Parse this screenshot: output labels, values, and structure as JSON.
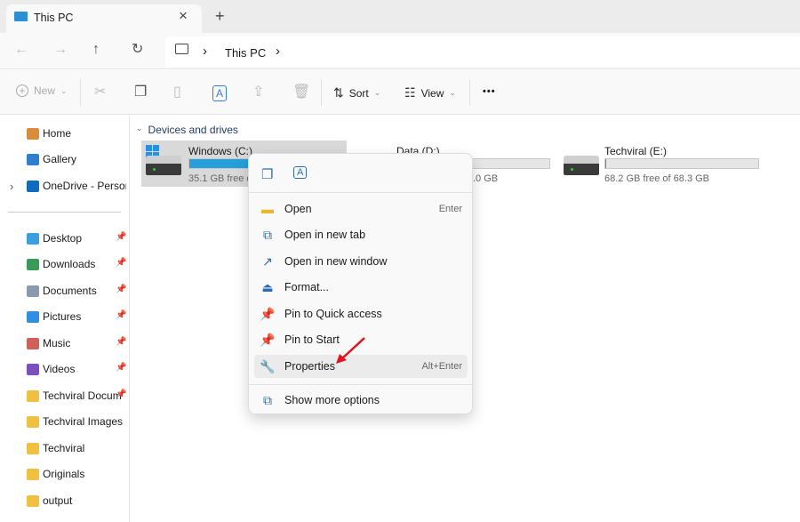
{
  "tab": {
    "title": "This PC",
    "close": "×",
    "new_tab": "+"
  },
  "nav": {
    "back": "←",
    "forward": "→",
    "up": "↑",
    "refresh": "↻",
    "crumb_sep": "›",
    "breadcrumb": "This PC"
  },
  "toolbar": {
    "new_label": "New",
    "sort_label": "Sort",
    "view_label": "View",
    "more": "•••",
    "chevron": "⌄"
  },
  "sidebar": {
    "items": [
      {
        "label": "Home",
        "icon": "home-icon",
        "color": "#d98c3a"
      },
      {
        "label": "Gallery",
        "icon": "gallery-icon",
        "color": "#2f7fd0"
      },
      {
        "label": "OneDrive - Persona",
        "icon": "cloud-icon",
        "color": "#0f6cbd"
      },
      {
        "label": "Desktop",
        "icon": "desktop-icon",
        "color": "#3aa0e0",
        "pinned": true
      },
      {
        "label": "Downloads",
        "icon": "download-icon",
        "color": "#3a9a5a",
        "pinned": true
      },
      {
        "label": "Documents",
        "icon": "document-icon",
        "color": "#8a9bb0",
        "pinned": true
      },
      {
        "label": "Pictures",
        "icon": "pictures-icon",
        "color": "#2f8fe0",
        "pinned": true
      },
      {
        "label": "Music",
        "icon": "music-icon",
        "color": "#d0605a",
        "pinned": true
      },
      {
        "label": "Videos",
        "icon": "videos-icon",
        "color": "#7a4fc0",
        "pinned": true
      },
      {
        "label": "Techviral Docum",
        "icon": "folder-icon",
        "color": "#f0c040",
        "pinned": true
      },
      {
        "label": "Techviral Images",
        "icon": "folder-icon",
        "color": "#f0c040"
      },
      {
        "label": "Techviral",
        "icon": "folder-icon",
        "color": "#f0c040"
      },
      {
        "label": "Originals",
        "icon": "folder-icon",
        "color": "#f0c040"
      },
      {
        "label": "output",
        "icon": "folder-icon",
        "color": "#f0c040"
      }
    ]
  },
  "main": {
    "section": "Devices and drives",
    "drives": [
      {
        "name": "Windows (C:)",
        "free": "35.1 GB free c",
        "used_fraction": 0.85,
        "selected": true
      },
      {
        "name": "Data (D:)",
        "free": ".0 GB",
        "used_fraction": 0.0
      },
      {
        "name": "Techviral (E:)",
        "free": "68.2 GB free of 68.3 GB",
        "used_fraction": 0.002
      }
    ]
  },
  "context_menu": {
    "items": [
      {
        "label": "Open",
        "shortcut": "Enter",
        "icon": "folder-open-icon"
      },
      {
        "label": "Open in new tab",
        "shortcut": "",
        "icon": "new-tab-icon"
      },
      {
        "label": "Open in new window",
        "shortcut": "",
        "icon": "new-window-icon"
      },
      {
        "label": "Format...",
        "shortcut": "",
        "icon": "format-icon"
      },
      {
        "label": "Pin to Quick access",
        "shortcut": "",
        "icon": "pin-icon"
      },
      {
        "label": "Pin to Start",
        "shortcut": "",
        "icon": "pin-icon"
      },
      {
        "label": "Properties",
        "shortcut": "Alt+Enter",
        "icon": "wrench-icon",
        "highlighted": true
      },
      {
        "label": "Show more options",
        "shortcut": "",
        "icon": "more-options-icon"
      }
    ]
  },
  "colors": {
    "accent": "#26a0da",
    "annotation_arrow": "#e0141e"
  }
}
